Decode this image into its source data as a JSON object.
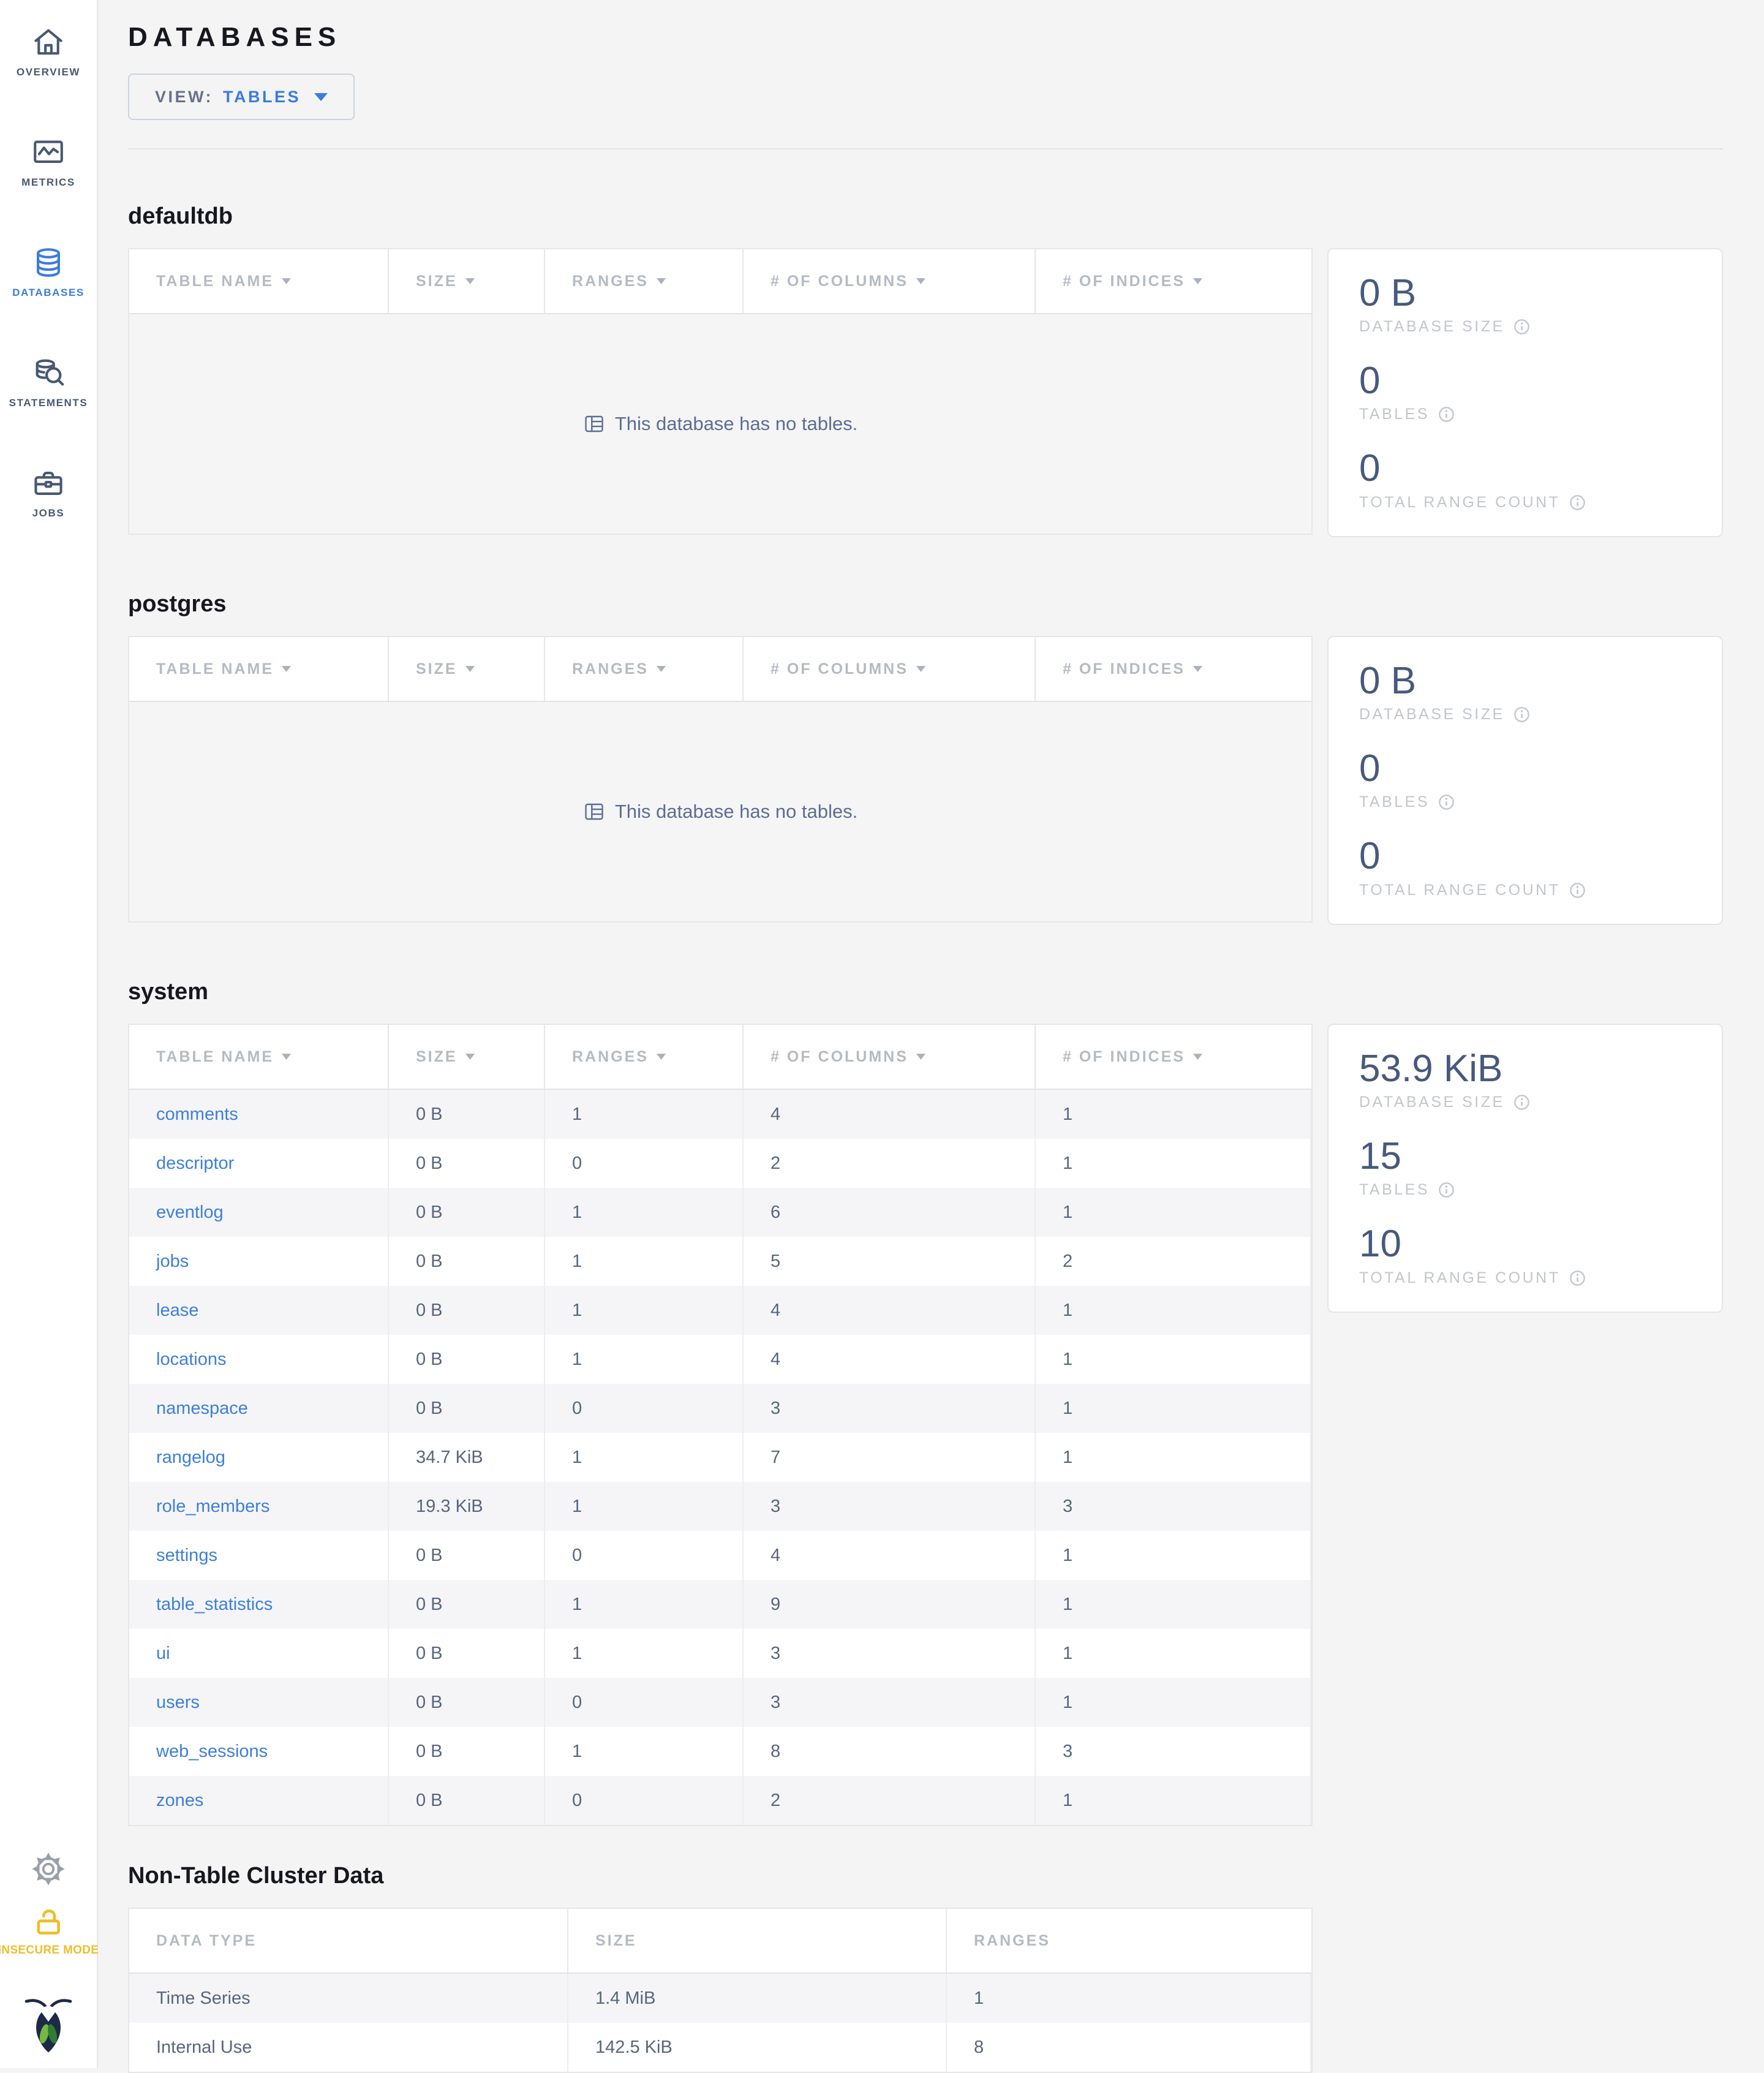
{
  "sidebar": {
    "items": [
      {
        "label": "OVERVIEW",
        "icon": "home-icon",
        "active": false
      },
      {
        "label": "METRICS",
        "icon": "metrics-icon",
        "active": false
      },
      {
        "label": "DATABASES",
        "icon": "databases-icon",
        "active": true
      },
      {
        "label": "STATEMENTS",
        "icon": "statements-icon",
        "active": false
      },
      {
        "label": "JOBS",
        "icon": "jobs-icon",
        "active": false
      }
    ],
    "insecure_label": "INSECURE MODE"
  },
  "header": {
    "title": "DATABASES",
    "view_label": "VIEW:",
    "view_value": "TABLES"
  },
  "db_columns": [
    "TABLE NAME",
    "SIZE",
    "RANGES",
    "# OF COLUMNS",
    "# OF INDICES"
  ],
  "empty_message": "This database has no tables.",
  "databases": [
    {
      "name": "defaultdb",
      "tables": null,
      "stats": [
        {
          "value": "0 B",
          "label": "DATABASE SIZE"
        },
        {
          "value": "0",
          "label": "TABLES"
        },
        {
          "value": "0",
          "label": "TOTAL RANGE COUNT"
        }
      ]
    },
    {
      "name": "postgres",
      "tables": null,
      "stats": [
        {
          "value": "0 B",
          "label": "DATABASE SIZE"
        },
        {
          "value": "0",
          "label": "TABLES"
        },
        {
          "value": "0",
          "label": "TOTAL RANGE COUNT"
        }
      ]
    },
    {
      "name": "system",
      "tables": [
        {
          "name": "comments",
          "size": "0 B",
          "ranges": "1",
          "columns": "4",
          "indices": "1"
        },
        {
          "name": "descriptor",
          "size": "0 B",
          "ranges": "0",
          "columns": "2",
          "indices": "1"
        },
        {
          "name": "eventlog",
          "size": "0 B",
          "ranges": "1",
          "columns": "6",
          "indices": "1"
        },
        {
          "name": "jobs",
          "size": "0 B",
          "ranges": "1",
          "columns": "5",
          "indices": "2"
        },
        {
          "name": "lease",
          "size": "0 B",
          "ranges": "1",
          "columns": "4",
          "indices": "1"
        },
        {
          "name": "locations",
          "size": "0 B",
          "ranges": "1",
          "columns": "4",
          "indices": "1"
        },
        {
          "name": "namespace",
          "size": "0 B",
          "ranges": "0",
          "columns": "3",
          "indices": "1"
        },
        {
          "name": "rangelog",
          "size": "34.7 KiB",
          "ranges": "1",
          "columns": "7",
          "indices": "1"
        },
        {
          "name": "role_members",
          "size": "19.3 KiB",
          "ranges": "1",
          "columns": "3",
          "indices": "3"
        },
        {
          "name": "settings",
          "size": "0 B",
          "ranges": "0",
          "columns": "4",
          "indices": "1"
        },
        {
          "name": "table_statistics",
          "size": "0 B",
          "ranges": "1",
          "columns": "9",
          "indices": "1"
        },
        {
          "name": "ui",
          "size": "0 B",
          "ranges": "1",
          "columns": "3",
          "indices": "1"
        },
        {
          "name": "users",
          "size": "0 B",
          "ranges": "0",
          "columns": "3",
          "indices": "1"
        },
        {
          "name": "web_sessions",
          "size": "0 B",
          "ranges": "1",
          "columns": "8",
          "indices": "3"
        },
        {
          "name": "zones",
          "size": "0 B",
          "ranges": "0",
          "columns": "2",
          "indices": "1"
        }
      ],
      "stats": [
        {
          "value": "53.9 KiB",
          "label": "DATABASE SIZE"
        },
        {
          "value": "15",
          "label": "TABLES"
        },
        {
          "value": "10",
          "label": "TOTAL RANGE COUNT"
        }
      ]
    }
  ],
  "non_table": {
    "title": "Non-Table Cluster Data",
    "columns": [
      "DATA TYPE",
      "SIZE",
      "RANGES"
    ],
    "rows": [
      {
        "type": "Time Series",
        "size": "1.4 MiB",
        "ranges": "1"
      },
      {
        "type": "Internal Use",
        "size": "142.5 KiB",
        "ranges": "8"
      }
    ]
  },
  "colors": {
    "accent_blue": "#3a7ce0",
    "link_blue": "#3d7fdb",
    "stat_slate": "#475a7d",
    "insecure_yellow": "#eebe29",
    "logo_navy": "#1c2a47",
    "logo_green_light": "#76b841",
    "logo_green_dark": "#2e7d33"
  }
}
